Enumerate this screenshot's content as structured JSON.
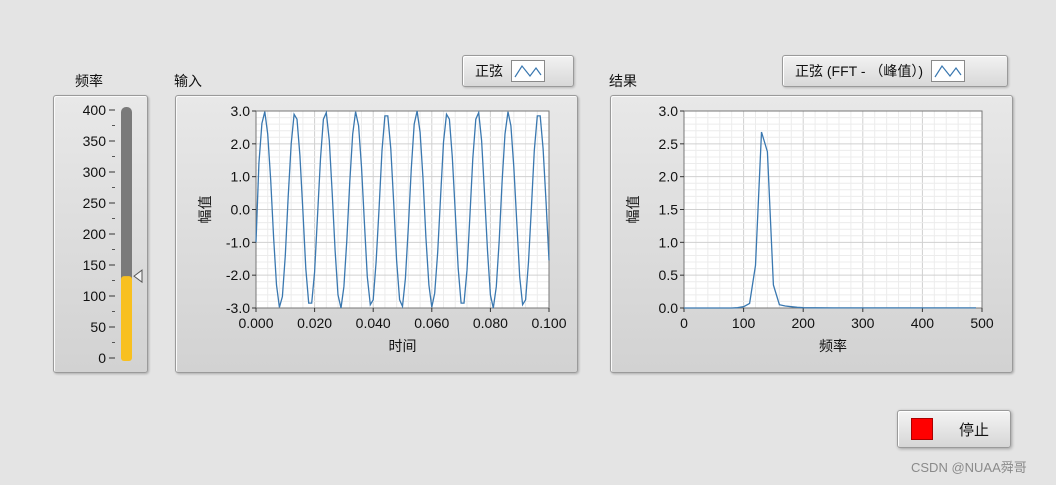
{
  "labels": {
    "freq": "频率",
    "input": "输入",
    "result": "结果"
  },
  "freq_control": {
    "ticks": [
      "400",
      "350",
      "300",
      "250",
      "200",
      "150",
      "100",
      "50",
      "0"
    ],
    "value": 132,
    "min": 0,
    "max": 400,
    "fill_color": "#f8c020",
    "track_color": "#7a7a7a"
  },
  "legend_input": {
    "text": "正弦"
  },
  "legend_result": {
    "text": "正弦 (FFT - （峰值）)"
  },
  "stop_button": {
    "label": "停止",
    "led_color": "#ff0000"
  },
  "watermark": "CSDN @NUAA舜哥",
  "chart_data": [
    {
      "type": "line",
      "xlabel": "时间",
      "ylabel": "幅值",
      "xlim": [
        0,
        0.1
      ],
      "ylim": [
        -3,
        3
      ],
      "xticks": [
        "0.000",
        "0.020",
        "0.040",
        "0.060",
        "0.080",
        "0.100"
      ],
      "yticks": [
        "3.0",
        "2.0",
        "1.0",
        "0.0",
        "-1.0",
        "-2.0",
        "-3.0"
      ],
      "grid": true,
      "series": [
        {
          "color": "#3a78b0",
          "frequency": 132,
          "amplitude": 3,
          "x": [
            0,
            0.001,
            0.002,
            0.003,
            0.004,
            0.005,
            0.006,
            0.007,
            0.008,
            0.009,
            0.01,
            0.011,
            0.012,
            0.013,
            0.014,
            0.015,
            0.016,
            0.017,
            0.018,
            0.019,
            0.02,
            0.021,
            0.022,
            0.023,
            0.024,
            0.025,
            0.026,
            0.027,
            0.028,
            0.029,
            0.03,
            0.031,
            0.032,
            0.033,
            0.034,
            0.035,
            0.036,
            0.037,
            0.038,
            0.039,
            0.04,
            0.041,
            0.042,
            0.043,
            0.044,
            0.045,
            0.046,
            0.047,
            0.048,
            0.049,
            0.05,
            0.051,
            0.052,
            0.053,
            0.054,
            0.055,
            0.056,
            0.057,
            0.058,
            0.059,
            0.06,
            0.061,
            0.062,
            0.063,
            0.064,
            0.065,
            0.066,
            0.067,
            0.068,
            0.069,
            0.07,
            0.071,
            0.072,
            0.073,
            0.074,
            0.075,
            0.076,
            0.077,
            0.078,
            0.079,
            0.08,
            0.081,
            0.082,
            0.083,
            0.084,
            0.085,
            0.086,
            0.087,
            0.088,
            0.089,
            0.09,
            0.091,
            0.092,
            0.093,
            0.094,
            0.095,
            0.096,
            0.097,
            0.098,
            0.099,
            0.1
          ],
          "y": [
            -1.0,
            1.4,
            2.62,
            2.98,
            2.3,
            0.9,
            -0.85,
            -2.3,
            -2.98,
            -2.65,
            -1.4,
            0.4,
            2.0,
            2.9,
            2.75,
            1.65,
            -0.05,
            -1.8,
            -2.85,
            -2.85,
            -1.9,
            -0.2,
            1.55,
            2.75,
            2.95,
            2.1,
            0.5,
            -1.25,
            -2.6,
            -3.0,
            -2.35,
            -0.95,
            0.85,
            2.3,
            2.98,
            2.55,
            1.3,
            -0.4,
            -2.05,
            -2.9,
            -2.75,
            -1.6,
            0.05,
            1.8,
            2.85,
            2.85,
            1.85,
            0.2,
            -1.55,
            -2.75,
            -2.95,
            -2.1,
            -0.5,
            1.25,
            2.6,
            3.0,
            2.35,
            0.95,
            -0.85,
            -2.3,
            -2.98,
            -2.55,
            -1.3,
            0.4,
            2.05,
            2.9,
            2.75,
            1.6,
            -0.05,
            -1.8,
            -2.85,
            -2.85,
            -1.85,
            -0.2,
            1.55,
            2.75,
            2.95,
            2.1,
            0.5,
            -1.25,
            -2.6,
            -3.0,
            -2.35,
            -0.95,
            0.85,
            2.3,
            2.98,
            2.55,
            1.3,
            -0.4,
            -2.05,
            -2.9,
            -2.75,
            -1.6,
            0.05,
            1.8,
            2.85,
            2.85,
            1.85,
            0.2,
            -1.55
          ]
        }
      ]
    },
    {
      "type": "line",
      "xlabel": "频率",
      "ylabel": "幅值",
      "xlim": [
        0,
        500
      ],
      "ylim": [
        0,
        3
      ],
      "xticks": [
        "0",
        "100",
        "200",
        "300",
        "400",
        "500"
      ],
      "yticks": [
        "3.0",
        "2.5",
        "2.0",
        "1.5",
        "1.0",
        "0.5",
        "0.0"
      ],
      "grid": true,
      "series": [
        {
          "color": "#3a78b0",
          "x": [
            0,
            20,
            40,
            60,
            80,
            90,
            100,
            110,
            120,
            130,
            140,
            150,
            160,
            170,
            180,
            190,
            200,
            220,
            250,
            300,
            350,
            400,
            450,
            490
          ],
          "y": [
            0,
            0,
            0,
            0,
            0,
            0.005,
            0.02,
            0.07,
            0.65,
            2.68,
            2.38,
            0.35,
            0.05,
            0.03,
            0.02,
            0.01,
            0.005,
            0.003,
            0.002,
            0.001,
            0.001,
            0.001,
            0.001,
            0.001
          ]
        }
      ]
    }
  ]
}
